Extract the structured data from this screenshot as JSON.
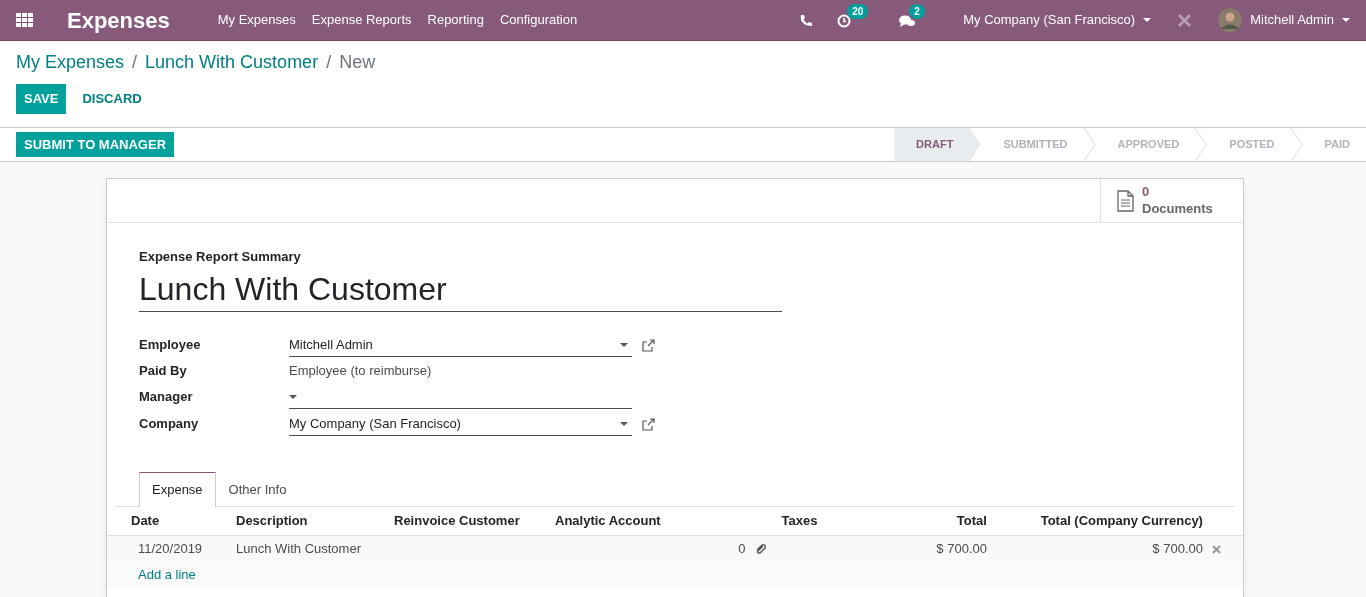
{
  "navbar": {
    "app_title": "Expenses",
    "menu": [
      "My Expenses",
      "Expense Reports",
      "Reporting",
      "Configuration"
    ],
    "activity_count": "20",
    "message_count": "2",
    "company": "My Company (San Francisco)",
    "user": "Mitchell Admin"
  },
  "breadcrumbs": [
    {
      "label": "My Expenses",
      "link": true
    },
    {
      "separator": "/",
      "label": "Lunch With Customer",
      "link": true
    },
    {
      "separator": "/",
      "label": "New",
      "link": false
    }
  ],
  "buttons": {
    "save": "SAVE",
    "discard": "DISCARD",
    "submit": "SUBMIT TO MANAGER"
  },
  "stages": [
    {
      "label": "DRAFT",
      "selected": true
    },
    {
      "label": "SUBMITTED",
      "selected": false
    },
    {
      "label": "APPROVED",
      "selected": false
    },
    {
      "label": "POSTED",
      "selected": false
    },
    {
      "label": "PAID",
      "selected": false
    }
  ],
  "documents": {
    "count": "0",
    "label": "Documents"
  },
  "summary": {
    "label": "Expense Report Summary",
    "value": "Lunch With Customer"
  },
  "fields": [
    {
      "label": "Employee",
      "value": "Mitchell Admin",
      "kind": "many2one",
      "external_link": true
    },
    {
      "label": "Paid By",
      "value": "Employee (to reimburse)",
      "kind": "readonly",
      "external_link": false
    },
    {
      "label": "Manager",
      "kind": "many2one",
      "external_link": false
    },
    {
      "label": "Company",
      "value": "My Company (San Francisco)",
      "kind": "many2one",
      "external_link": true
    }
  ],
  "tabs": [
    {
      "label": "Expense",
      "selected": true
    },
    {
      "label": "Other Info",
      "selected": false
    }
  ],
  "table": {
    "columns": [
      "Date",
      "Description",
      "Reinvoice Customer",
      "Analytic Account",
      "",
      "Taxes",
      "Total",
      "Total (Company Currency)"
    ],
    "rows": [
      {
        "cells": [
          "11/20/2019",
          "Lunch With Customer",
          "",
          "",
          "0",
          "",
          "$ 700.00",
          "$ 700.00"
        ]
      }
    ],
    "add_line": "Add a line"
  }
}
